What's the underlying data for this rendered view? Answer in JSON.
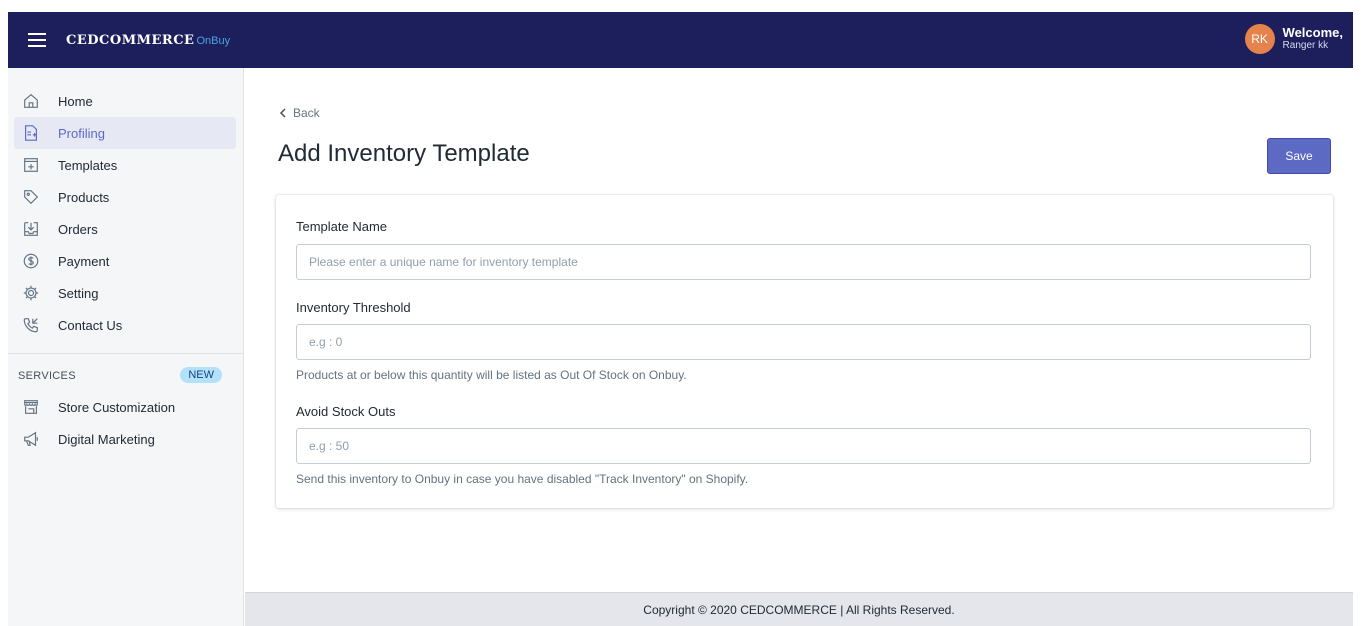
{
  "header": {
    "logo_main": "CEDCOMMERCE",
    "logo_sub": "OnBuy",
    "avatar_initials": "RK",
    "welcome_label": "Welcome,",
    "user_name": "Ranger kk",
    "colors": {
      "bar": "#1d1f5c",
      "avatar": "#e6824b"
    }
  },
  "sidebar": {
    "items": [
      {
        "label": "Home",
        "icon": "home-icon"
      },
      {
        "label": "Profiling",
        "icon": "profiling-icon",
        "active": true
      },
      {
        "label": "Templates",
        "icon": "templates-icon"
      },
      {
        "label": "Products",
        "icon": "tag-icon"
      },
      {
        "label": "Orders",
        "icon": "orders-download-icon"
      },
      {
        "label": "Payment",
        "icon": "dollar-circle-icon"
      },
      {
        "label": "Setting",
        "icon": "gear-icon"
      },
      {
        "label": "Contact Us",
        "icon": "phone-icon"
      }
    ],
    "services_title": "SERVICES",
    "services_badge": "NEW",
    "services": [
      {
        "label": "Store Customization",
        "icon": "store-icon"
      },
      {
        "label": "Digital Marketing",
        "icon": "megaphone-icon"
      }
    ]
  },
  "main": {
    "back_label": "Back",
    "title": "Add Inventory Template",
    "save_label": "Save",
    "accent": "#5c6ac4",
    "form": {
      "template_name_label": "Template Name",
      "template_name_placeholder": "Please enter a unique name for inventory template",
      "template_name_value": "",
      "threshold_label": "Inventory Threshold",
      "threshold_placeholder": "e.g : 0",
      "threshold_value": "",
      "threshold_help": "Products at or below this quantity will be listed as Out Of Stock on Onbuy.",
      "avoid_label": "Avoid Stock Outs",
      "avoid_placeholder": "e.g : 50",
      "avoid_value": "",
      "avoid_help": "Send this inventory to Onbuy in case you have disabled \"Track Inventory\" on Shopify."
    }
  },
  "footer": {
    "copyright": "Copyright © 2020 CEDCOMMERCE | All Rights Reserved."
  }
}
